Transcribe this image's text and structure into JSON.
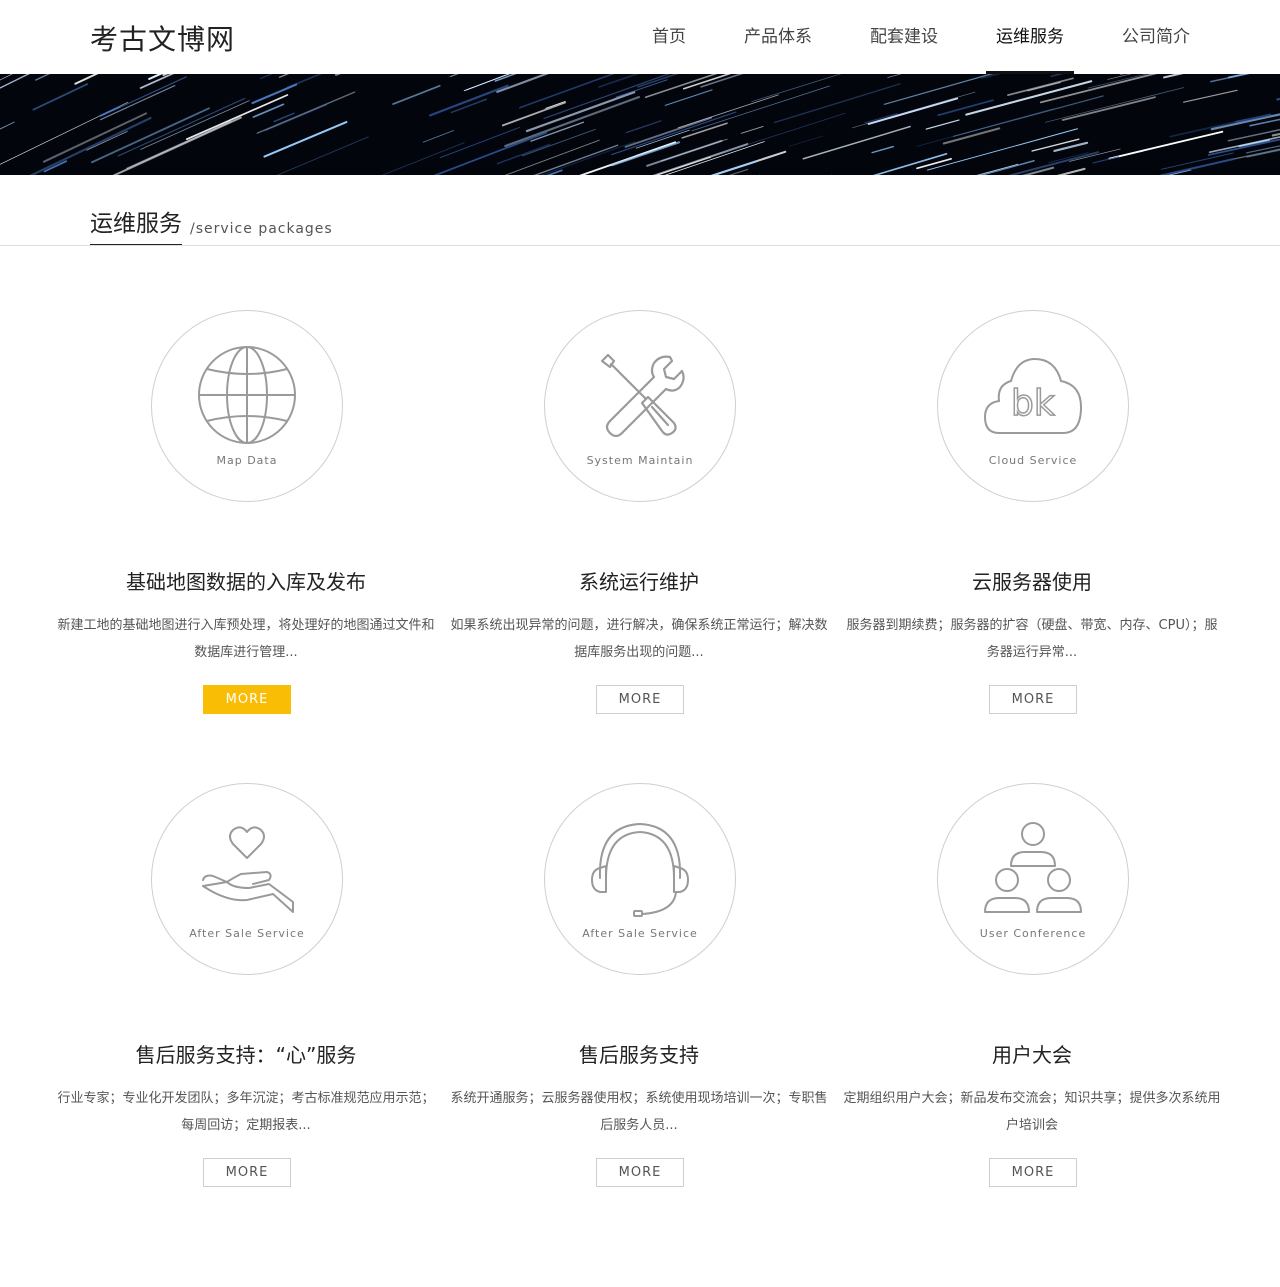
{
  "header": {
    "logo": "考古文博网",
    "nav": [
      {
        "label": "首页",
        "active": false
      },
      {
        "label": "产品体系",
        "active": false
      },
      {
        "label": "配套建设",
        "active": false
      },
      {
        "label": "运维服务",
        "active": true
      },
      {
        "label": "公司简介",
        "active": false
      }
    ]
  },
  "banner": {
    "icon": "star-trail-banner"
  },
  "section": {
    "title": "运维服务",
    "subtitle": "/service packages"
  },
  "services": [
    {
      "icon": "globe-icon",
      "circle_label": "Map Data",
      "title": "基础地图数据的入库及发布",
      "desc": "新建工地的基础地图进行入库预处理，将处理好的地图通过文件和数据库进行管理...",
      "more": "MORE",
      "highlight": true
    },
    {
      "icon": "tools-icon",
      "circle_label": "System Maintain",
      "title": "系统运行维护",
      "desc": "如果系统出现异常的问题，进行解决，确保系统正常运行；解决数据库服务出现的问题...",
      "more": "MORE",
      "highlight": false
    },
    {
      "icon": "cloud-icon",
      "circle_label": "Cloud Service",
      "title": "云服务器使用",
      "desc": "服务器到期续费；服务器的扩容（硬盘、带宽、内存、CPU）；服务器运行异常...",
      "more": "MORE",
      "highlight": false
    },
    {
      "icon": "heart-hand-icon",
      "circle_label": "After Sale Service",
      "title": "售后服务支持：“心”服务",
      "desc": "行业专家；专业化开发团队；多年沉淀；考古标准规范应用示范；每周回访；定期报表...",
      "more": "MORE",
      "highlight": false
    },
    {
      "icon": "headset-icon",
      "circle_label": "After Sale Service",
      "title": "售后服务支持",
      "desc": "系统开通服务；云服务器使用权；系统使用现场培训一次；专职售后服务人员...",
      "more": "MORE",
      "highlight": false
    },
    {
      "icon": "users-icon",
      "circle_label": "User Conference",
      "title": "用户大会",
      "desc": "定期组织用户大会；新品发布交流会；知识共享；提供多次系统用户培训会",
      "more": "MORE",
      "highlight": false
    }
  ],
  "colors": {
    "accent": "#f9bd05",
    "text": "#222222",
    "border": "#cfcfcf"
  }
}
